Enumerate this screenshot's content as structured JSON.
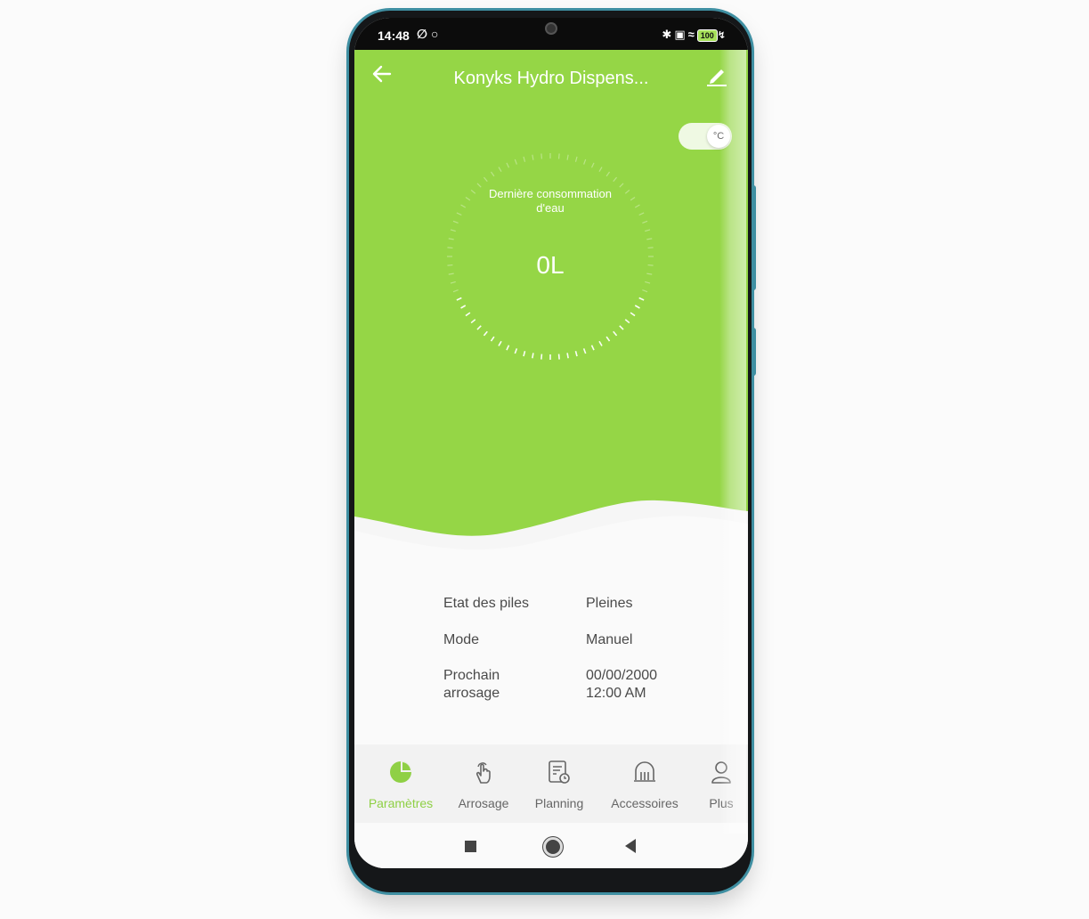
{
  "status_bar": {
    "time": "14:48",
    "battery": "100",
    "left_icons": [
      "mute-icon",
      "circle-icon"
    ],
    "right_icons": [
      "bluetooth-icon",
      "nfc-icon",
      "wifi-icon",
      "battery-icon",
      "charging-icon"
    ]
  },
  "header": {
    "title": "Konyks Hydro Dispens..."
  },
  "unit_toggle": {
    "label": "°C"
  },
  "gauge": {
    "label": "Dernière consommation\nd'eau",
    "value": "0L"
  },
  "info": {
    "rows": [
      {
        "label": "Etat des piles",
        "value": "Pleines"
      },
      {
        "label": "Mode",
        "value": "Manuel"
      },
      {
        "label": "Prochain\narrosage",
        "value": "00/00/2000\n12:00 AM"
      }
    ]
  },
  "nav": {
    "items": [
      {
        "label": "Paramètres",
        "icon": "pie-chart-icon",
        "active": true
      },
      {
        "label": "Arrosage",
        "icon": "hand-tap-icon",
        "active": false
      },
      {
        "label": "Planning",
        "icon": "schedule-icon",
        "active": false
      },
      {
        "label": "Accessoires",
        "icon": "accessory-icon",
        "active": false
      },
      {
        "label": "Plus",
        "icon": "user-icon",
        "active": false
      }
    ]
  },
  "colors": {
    "accent": "#95d646",
    "nav_active": "#8fd045",
    "frame": "#3f8fa2"
  }
}
